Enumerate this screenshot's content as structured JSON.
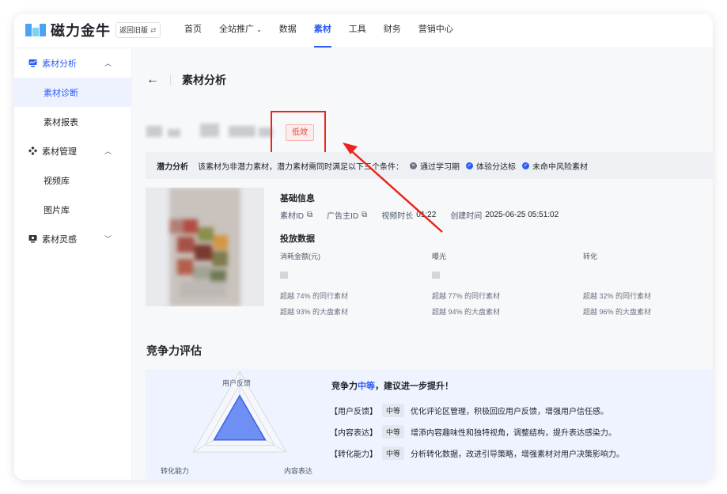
{
  "app": {
    "name": "磁力金牛",
    "back_old": "返回旧版",
    "back_old_icon": "swap-icon"
  },
  "nav": [
    {
      "label": "首页",
      "active": false
    },
    {
      "label": "全站推广",
      "active": false,
      "has_dropdown": true
    },
    {
      "label": "数据",
      "active": false
    },
    {
      "label": "素材",
      "active": true
    },
    {
      "label": "工具",
      "active": false
    },
    {
      "label": "财务",
      "active": false
    },
    {
      "label": "营销中心",
      "active": false
    }
  ],
  "sidebar": {
    "groups": [
      {
        "label": "素材分析",
        "expanded": true,
        "items": [
          "素材诊断",
          "素材报表"
        ]
      },
      {
        "label": "素材管理",
        "expanded": true,
        "items": [
          "视频库",
          "图片库"
        ]
      },
      {
        "label": "素材灵感",
        "expanded": false,
        "items": []
      }
    ],
    "active_item": "素材诊断"
  },
  "page": {
    "title": "素材分析",
    "status_badge": "低效",
    "potential": {
      "label": "潜力分析",
      "description": "该素材为非潜力素材，潜力素材需同时满足以下三个条件：",
      "conditions": [
        {
          "text": "通过学习期",
          "status": "fail"
        },
        {
          "text": "体验分达标",
          "status": "pass"
        },
        {
          "text": "未命中风险素材",
          "status": "pass"
        }
      ]
    },
    "basic_info": {
      "title": "基础信息",
      "material_id_label": "素材ID",
      "advertiser_id_label": "广告主ID",
      "duration_label": "视频时长",
      "duration_value": "01:22",
      "created_label": "创建时间",
      "created_value": "2025-06-25 05:51:02"
    },
    "delivery": {
      "title": "投放数据",
      "columns": [
        {
          "header": "消耗金额(元)",
          "beat_peer": "超越 74% 的同行素材",
          "beat_all": "超越 93% 的大盘素材"
        },
        {
          "header": "曝光",
          "beat_peer": "超越 77% 的同行素材",
          "beat_all": "超越 94% 的大盘素材"
        },
        {
          "header": "转化",
          "beat_peer": "超越 32% 的同行素材",
          "beat_all": "超越 96% 的大盘素材"
        }
      ]
    },
    "competitiveness": {
      "title": "竞争力评估",
      "radar_axes": [
        "用户反馈",
        "内容表达",
        "转化能力"
      ],
      "radar_values": [
        0.55,
        0.55,
        0.55
      ],
      "summary_prefix": "竞争力",
      "summary_level": "中等",
      "summary_suffix": "，建议进一步提升！",
      "suggestions": [
        {
          "dimension": "【用户反馈】",
          "level": "中等",
          "text": "优化评论区管理，积极回应用户反馈，增强用户信任感。"
        },
        {
          "dimension": "【内容表达】",
          "level": "中等",
          "text": "增添内容趣味性和独特视角，调整结构，提升表达感染力。"
        },
        {
          "dimension": "【转化能力】",
          "level": "中等",
          "text": "分析转化数据，改进引导策略，增强素材对用户决策影响力。"
        }
      ]
    }
  },
  "colors": {
    "accent": "#2c5cf6",
    "danger": "#e5423a",
    "annotation": "#e8261d"
  }
}
